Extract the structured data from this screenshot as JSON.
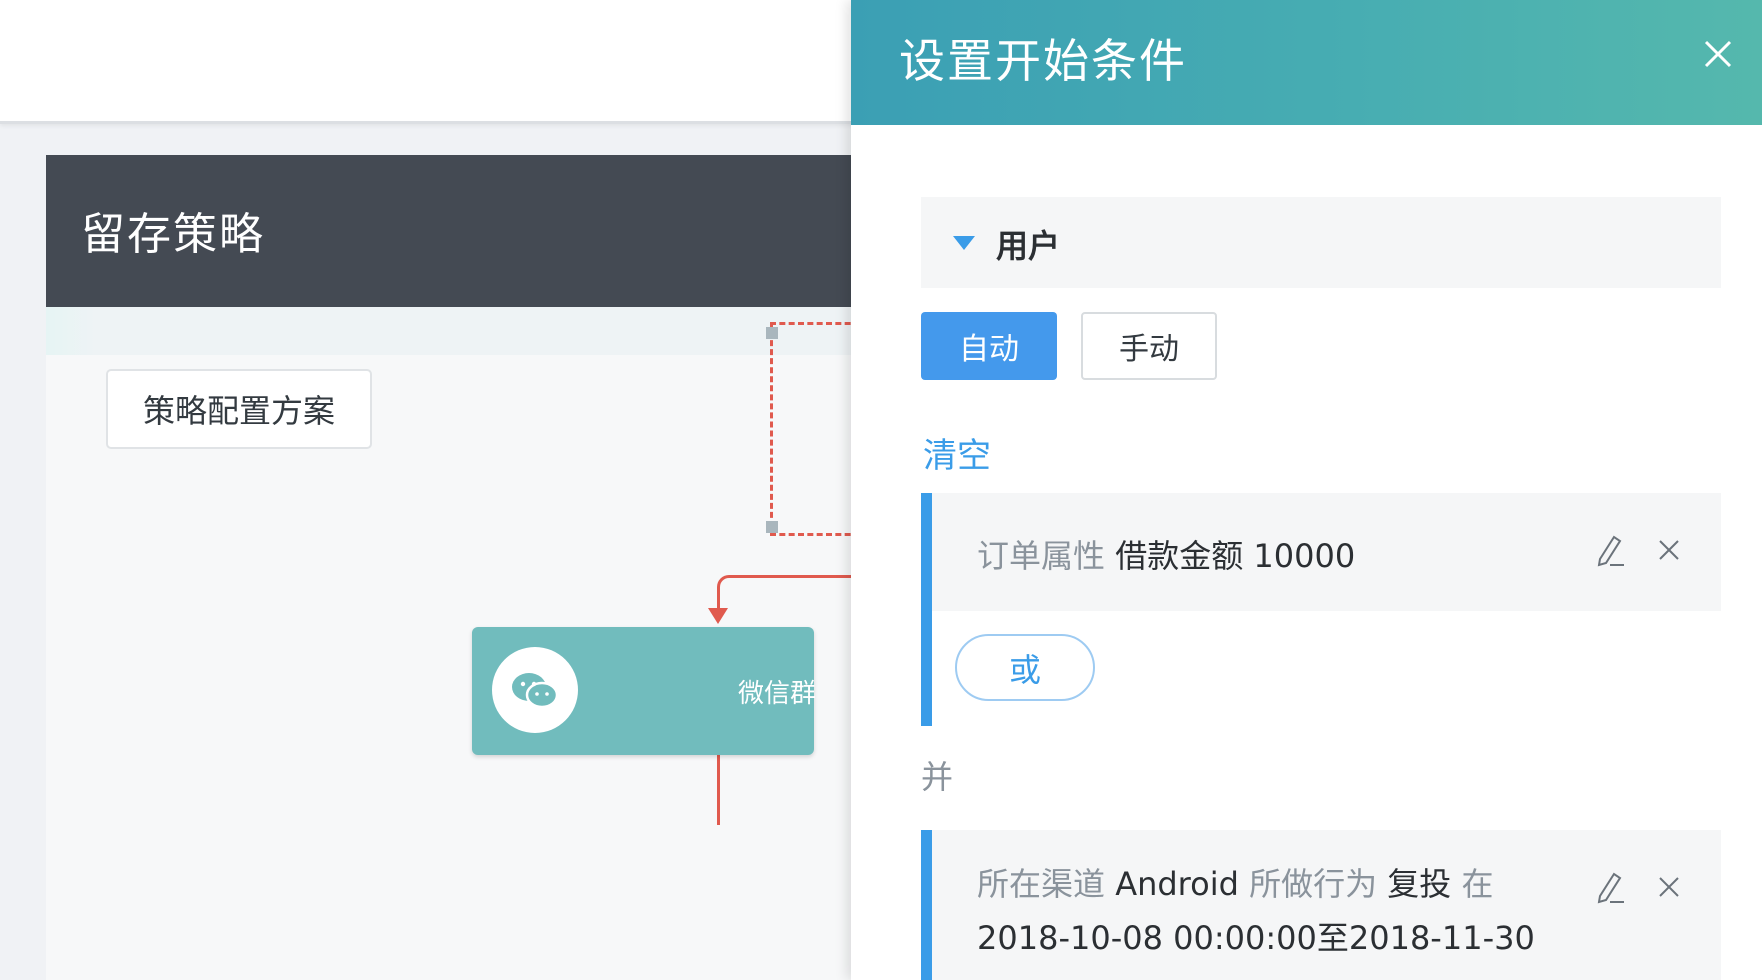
{
  "background": {
    "strategy_title": "留存策略",
    "plan_button_label": "策略配置方案",
    "wechat_node_label": "微信群"
  },
  "drawer": {
    "title": "设置开始条件",
    "user_section_label": "用户",
    "mode_auto_label": "自动",
    "mode_manual_label": "手动",
    "clear_label": "清空",
    "conditions": [
      {
        "category": "订单属性",
        "field": "借款金额",
        "value": "10000"
      },
      {
        "channel_label": "所在渠道",
        "channel_value": "Android",
        "action_label": "所做行为",
        "action_value": "复投",
        "at_label": "在",
        "date_range": "2018-10-08 00:00:00至2018-11-30"
      }
    ],
    "or_label": "或",
    "and_label": "并"
  },
  "colors": {
    "header_gradient_start": "#3b9fb4",
    "header_gradient_end": "#55b8ad",
    "accent_blue": "#4499ec",
    "dark_header": "#444a53",
    "node_teal": "#71bcbd",
    "flow_red": "#e05a4e"
  },
  "icons": [
    "close-icon",
    "caret-down-icon",
    "edit-icon",
    "remove-icon",
    "wechat-icon"
  ]
}
